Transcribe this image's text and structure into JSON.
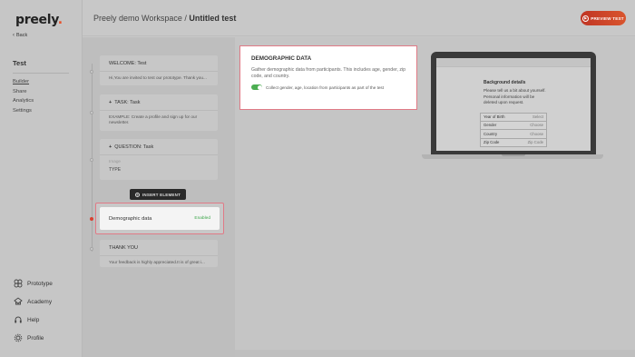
{
  "app": {
    "logo": "preely",
    "back": "Back"
  },
  "header": {
    "workspace": "Preely demo Workspace /",
    "test_name": "Untitled test",
    "preview_label": "PREVIEW TEST"
  },
  "sidebar": {
    "project_title": "Test",
    "nav": [
      {
        "label": "Builder",
        "active": true
      },
      {
        "label": "Share"
      },
      {
        "label": "Analytics"
      },
      {
        "label": "Settings"
      }
    ],
    "bottom": [
      {
        "label": "Prototype",
        "icon": "grid-icon"
      },
      {
        "label": "Academy",
        "icon": "academy-icon"
      },
      {
        "label": "Help",
        "icon": "headset-icon"
      },
      {
        "label": "Profile",
        "icon": "gear-icon"
      }
    ]
  },
  "builder": {
    "welcome": {
      "title": "WELCOME:  Test",
      "body": "Hi,You are invited to test our prototype. Thank you..."
    },
    "task": {
      "title": "TASK:  Task",
      "body": "EXAMPLE: Create a profile and sign up for our newsletter."
    },
    "question": {
      "title": "QUESTION:  Task",
      "placeholder": "Image",
      "type_label": "TYPE"
    },
    "insert_label": "INSERT ELEMENT",
    "demographic": {
      "label": "Demographic data",
      "status": "Enabled"
    },
    "thankyou": {
      "title": "THANK YOU",
      "body": "Your feedback is highly appreciated.It is of great i..."
    }
  },
  "config": {
    "title": "DEMOGRAPHIC DATA",
    "description": "Gather demographic data from participants. This includes age, gender, zip code, and country.",
    "toggle_label": "Collect gender, age, location from participants as part of the test",
    "toggle_on": true
  },
  "preview": {
    "title": "Background details",
    "description": "Please tell us a bit about yourself. Personal information will be deleted upon request.",
    "rows": [
      {
        "label": "Year of Birth",
        "action": "Select"
      },
      {
        "label": "Gender",
        "action": "Choose"
      },
      {
        "label": "Country",
        "action": "Choose"
      },
      {
        "label": "Zip Code",
        "action": "Zip Code"
      }
    ]
  },
  "colors": {
    "accent": "#d9452e",
    "enabled": "#3ca64a",
    "highlight": "#e07a86"
  }
}
